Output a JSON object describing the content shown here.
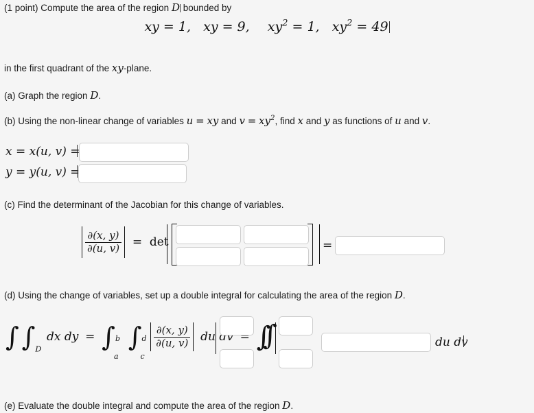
{
  "problem": {
    "points_label": "(1 point)",
    "intro_text": "Compute the area of the region",
    "intro_region": "D",
    "intro_tail": "bounded by",
    "display_equation": "xy = 1,  xy = 9,   xy² = 1,  xy² = 49",
    "equation_parts": {
      "eq1": "xy = 1,",
      "eq2": "xy = 9,",
      "eq3": "xy",
      "eq3_exp": "2",
      "eq3_rhs": "= 1,",
      "eq4": "xy",
      "eq4_exp": "2",
      "eq4_rhs": "= 49"
    },
    "quadrant_line_a": "in the first quadrant of the",
    "quadrant_plane": "xy",
    "quadrant_line_b": "-plane."
  },
  "parts": {
    "a": {
      "label": "(a) Graph the region",
      "region": "D",
      "tail": "."
    },
    "b": {
      "lead": "(b) Using the non-linear change of variables",
      "u_sym": "u",
      "u_eq": "=",
      "u_val": "xy",
      "and1": "and",
      "v_sym": "v",
      "v_eq": "=",
      "v_val": "xy",
      "v_exp": "2",
      "mid": ", find",
      "x_sym": "x",
      "and2": "and",
      "y_sym": "y",
      "tail1": "as functions of",
      "u_sym2": "u",
      "and3": "and",
      "v_sym2": "v",
      "tail2": ".",
      "x_row_label_1": "x",
      "x_row_label_2": "= x(u, v) =",
      "y_row_label_1": "y",
      "y_row_label_2": "= y(u, v) =",
      "x_answer": "",
      "y_answer": "",
      "x_placeholder": "",
      "y_placeholder": ""
    },
    "c": {
      "text": "(c) Find the determinant of the Jacobian for this change of variables.",
      "jacobian_num": "∂(x, y)",
      "jacobian_den": "∂(u, v)",
      "equals": "=",
      "det_label": "det",
      "result_equals": "=",
      "m11": "",
      "m12": "",
      "m21": "",
      "m22": "",
      "determinant": ""
    },
    "d": {
      "lead": "(d) Using the change of variables, set up a double integral for calculating the area of the region",
      "region": "D",
      "tail": ".",
      "formula": {
        "int1": "∫",
        "int2": "∫",
        "sub_D": "D",
        "dxdy": "dx dy",
        "eq1": "=",
        "int3": "∫",
        "sup_b": "b",
        "sub_a": "a",
        "int4": "∫",
        "sup_d": "d",
        "sub_c": "c",
        "jac_num": "∂(x, y)",
        "jac_den": "∂(u, v)",
        "dudv": "du dv",
        "eq2": "=",
        "int5": "∫",
        "int6": "∫",
        "dudv_end": "du dv"
      },
      "limit_upper_1": "",
      "limit_lower_1": "",
      "limit_upper_2": "",
      "limit_lower_2": "",
      "integrand": ""
    },
    "e": {
      "text": "(e) Evaluate the double integral and compute the area of the region",
      "region": "D",
      "tail": "."
    }
  },
  "colors": {
    "background": "#f5f5f5",
    "text": "#1a1a1a",
    "input_border": "#cdcdcd",
    "input_background": "#ffffff",
    "math": "#111111"
  }
}
